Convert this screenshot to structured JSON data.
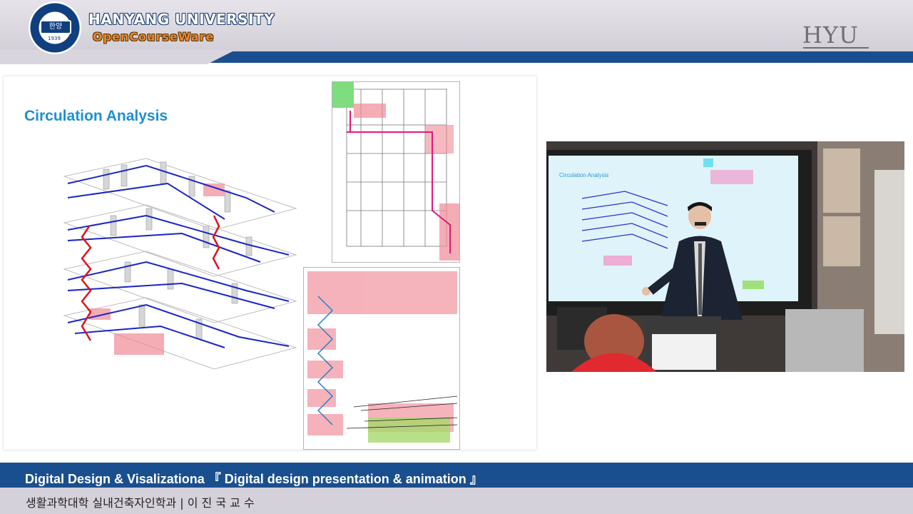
{
  "header": {
    "university": "HANYANG UNIVERSITY",
    "ocw": "OpenCourseWare",
    "seal_text": "한양",
    "seal_year": "1939",
    "brand": "HYU"
  },
  "slide": {
    "title": "Circulation Analysis"
  },
  "video": {
    "screen_title": "Circulation Analysis"
  },
  "footer": {
    "course": "Digital Design & Visalizationa 『 Digital design presentation & animation 』",
    "department": "생활과학대학 실내건축자인학과  |  이 진 국 교 수"
  },
  "colors": {
    "brand_blue": "#1a4f8f",
    "title_blue": "#1d8fd3",
    "circulation_blue": "#1a24c8",
    "circulation_red": "#d7161c",
    "zone_pink": "#f08a96"
  }
}
